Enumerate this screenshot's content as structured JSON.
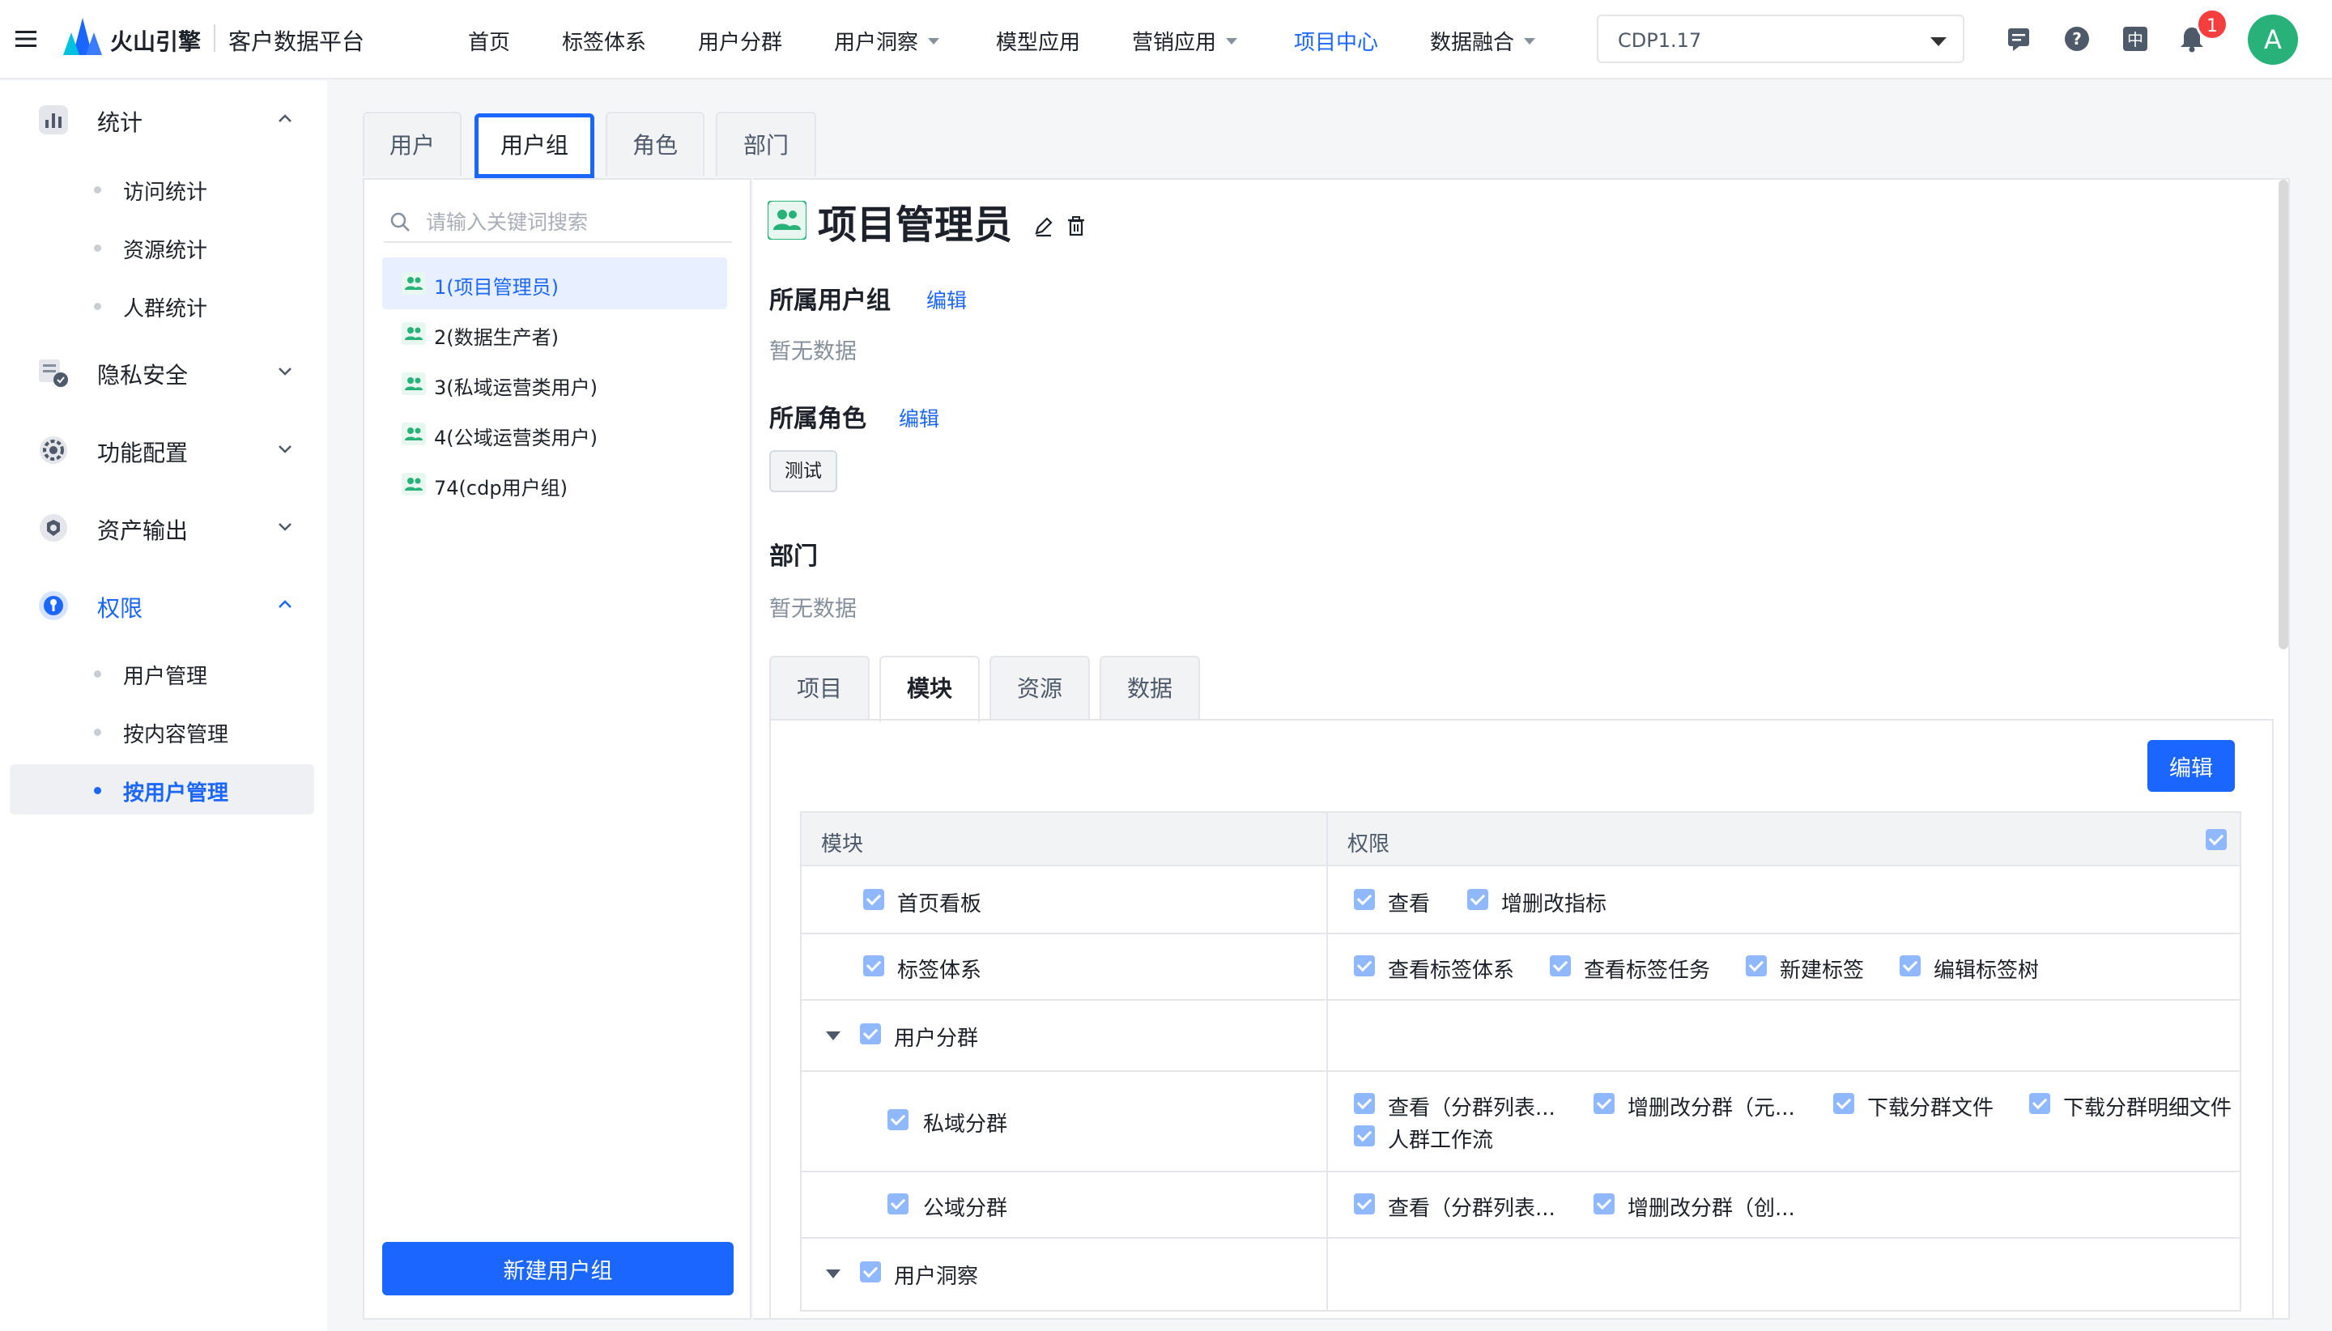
{
  "header": {
    "brand": "火山引擎",
    "platform": "客户数据平台",
    "nav": [
      {
        "label": "首页"
      },
      {
        "label": "标签体系"
      },
      {
        "label": "用户分群"
      },
      {
        "label": "用户洞察"
      },
      {
        "label": "模型应用"
      },
      {
        "label": "营销应用"
      },
      {
        "label": "项目中心"
      },
      {
        "label": "数据融合"
      }
    ],
    "version": "CDP1.17",
    "lang": "中",
    "notification_count": "1",
    "avatar": "A",
    "accent_color": "#1a66ff"
  },
  "sidebar": {
    "groups": [
      {
        "label": "统计",
        "items": [
          "访问统计",
          "资源统计",
          "人群统计"
        ]
      },
      {
        "label": "隐私安全"
      },
      {
        "label": "功能配置"
      },
      {
        "label": "资产输出"
      },
      {
        "label": "权限",
        "items": [
          "用户管理",
          "按内容管理",
          "按用户管理"
        ]
      }
    ]
  },
  "tabs": [
    "用户",
    "用户组",
    "角色",
    "部门"
  ],
  "list": {
    "search_placeholder": "请输入关键词搜索",
    "items": [
      "1(项目管理员)",
      "2(数据生产者)",
      "3(私域运营类用户)",
      "4(公域运营类用户)",
      "74(cdp用户组)"
    ],
    "new_button": "新建用户组"
  },
  "detail": {
    "title": "项目管理员",
    "user_group_heading": "所属用户组",
    "role_heading": "所属角色",
    "dept_heading": "部门",
    "edit_link": "编辑",
    "empty_text": "暂无数据",
    "role_tag": "测试",
    "subtabs": [
      "项目",
      "模块",
      "资源",
      "数据"
    ],
    "edit_button": "编辑",
    "table": {
      "col_module": "模块",
      "col_permission": "权限",
      "rows": [
        {
          "module": "首页看板",
          "perms": [
            "查看",
            "增删改指标"
          ]
        },
        {
          "module": "标签体系",
          "perms": [
            "查看标签体系",
            "查看标签任务",
            "新建标签",
            "编辑标签树"
          ]
        },
        {
          "module": "用户分群",
          "perms": []
        },
        {
          "module": "私域分群",
          "perms": [
            "查看（分群列表...",
            "增删改分群（元...",
            "下载分群文件",
            "下载分群明细文件",
            "人群工作流"
          ]
        },
        {
          "module": "公域分群",
          "perms": [
            "查看（分群列表...",
            "增删改分群（创..."
          ]
        },
        {
          "module": "用户洞察",
          "perms": []
        }
      ]
    }
  }
}
